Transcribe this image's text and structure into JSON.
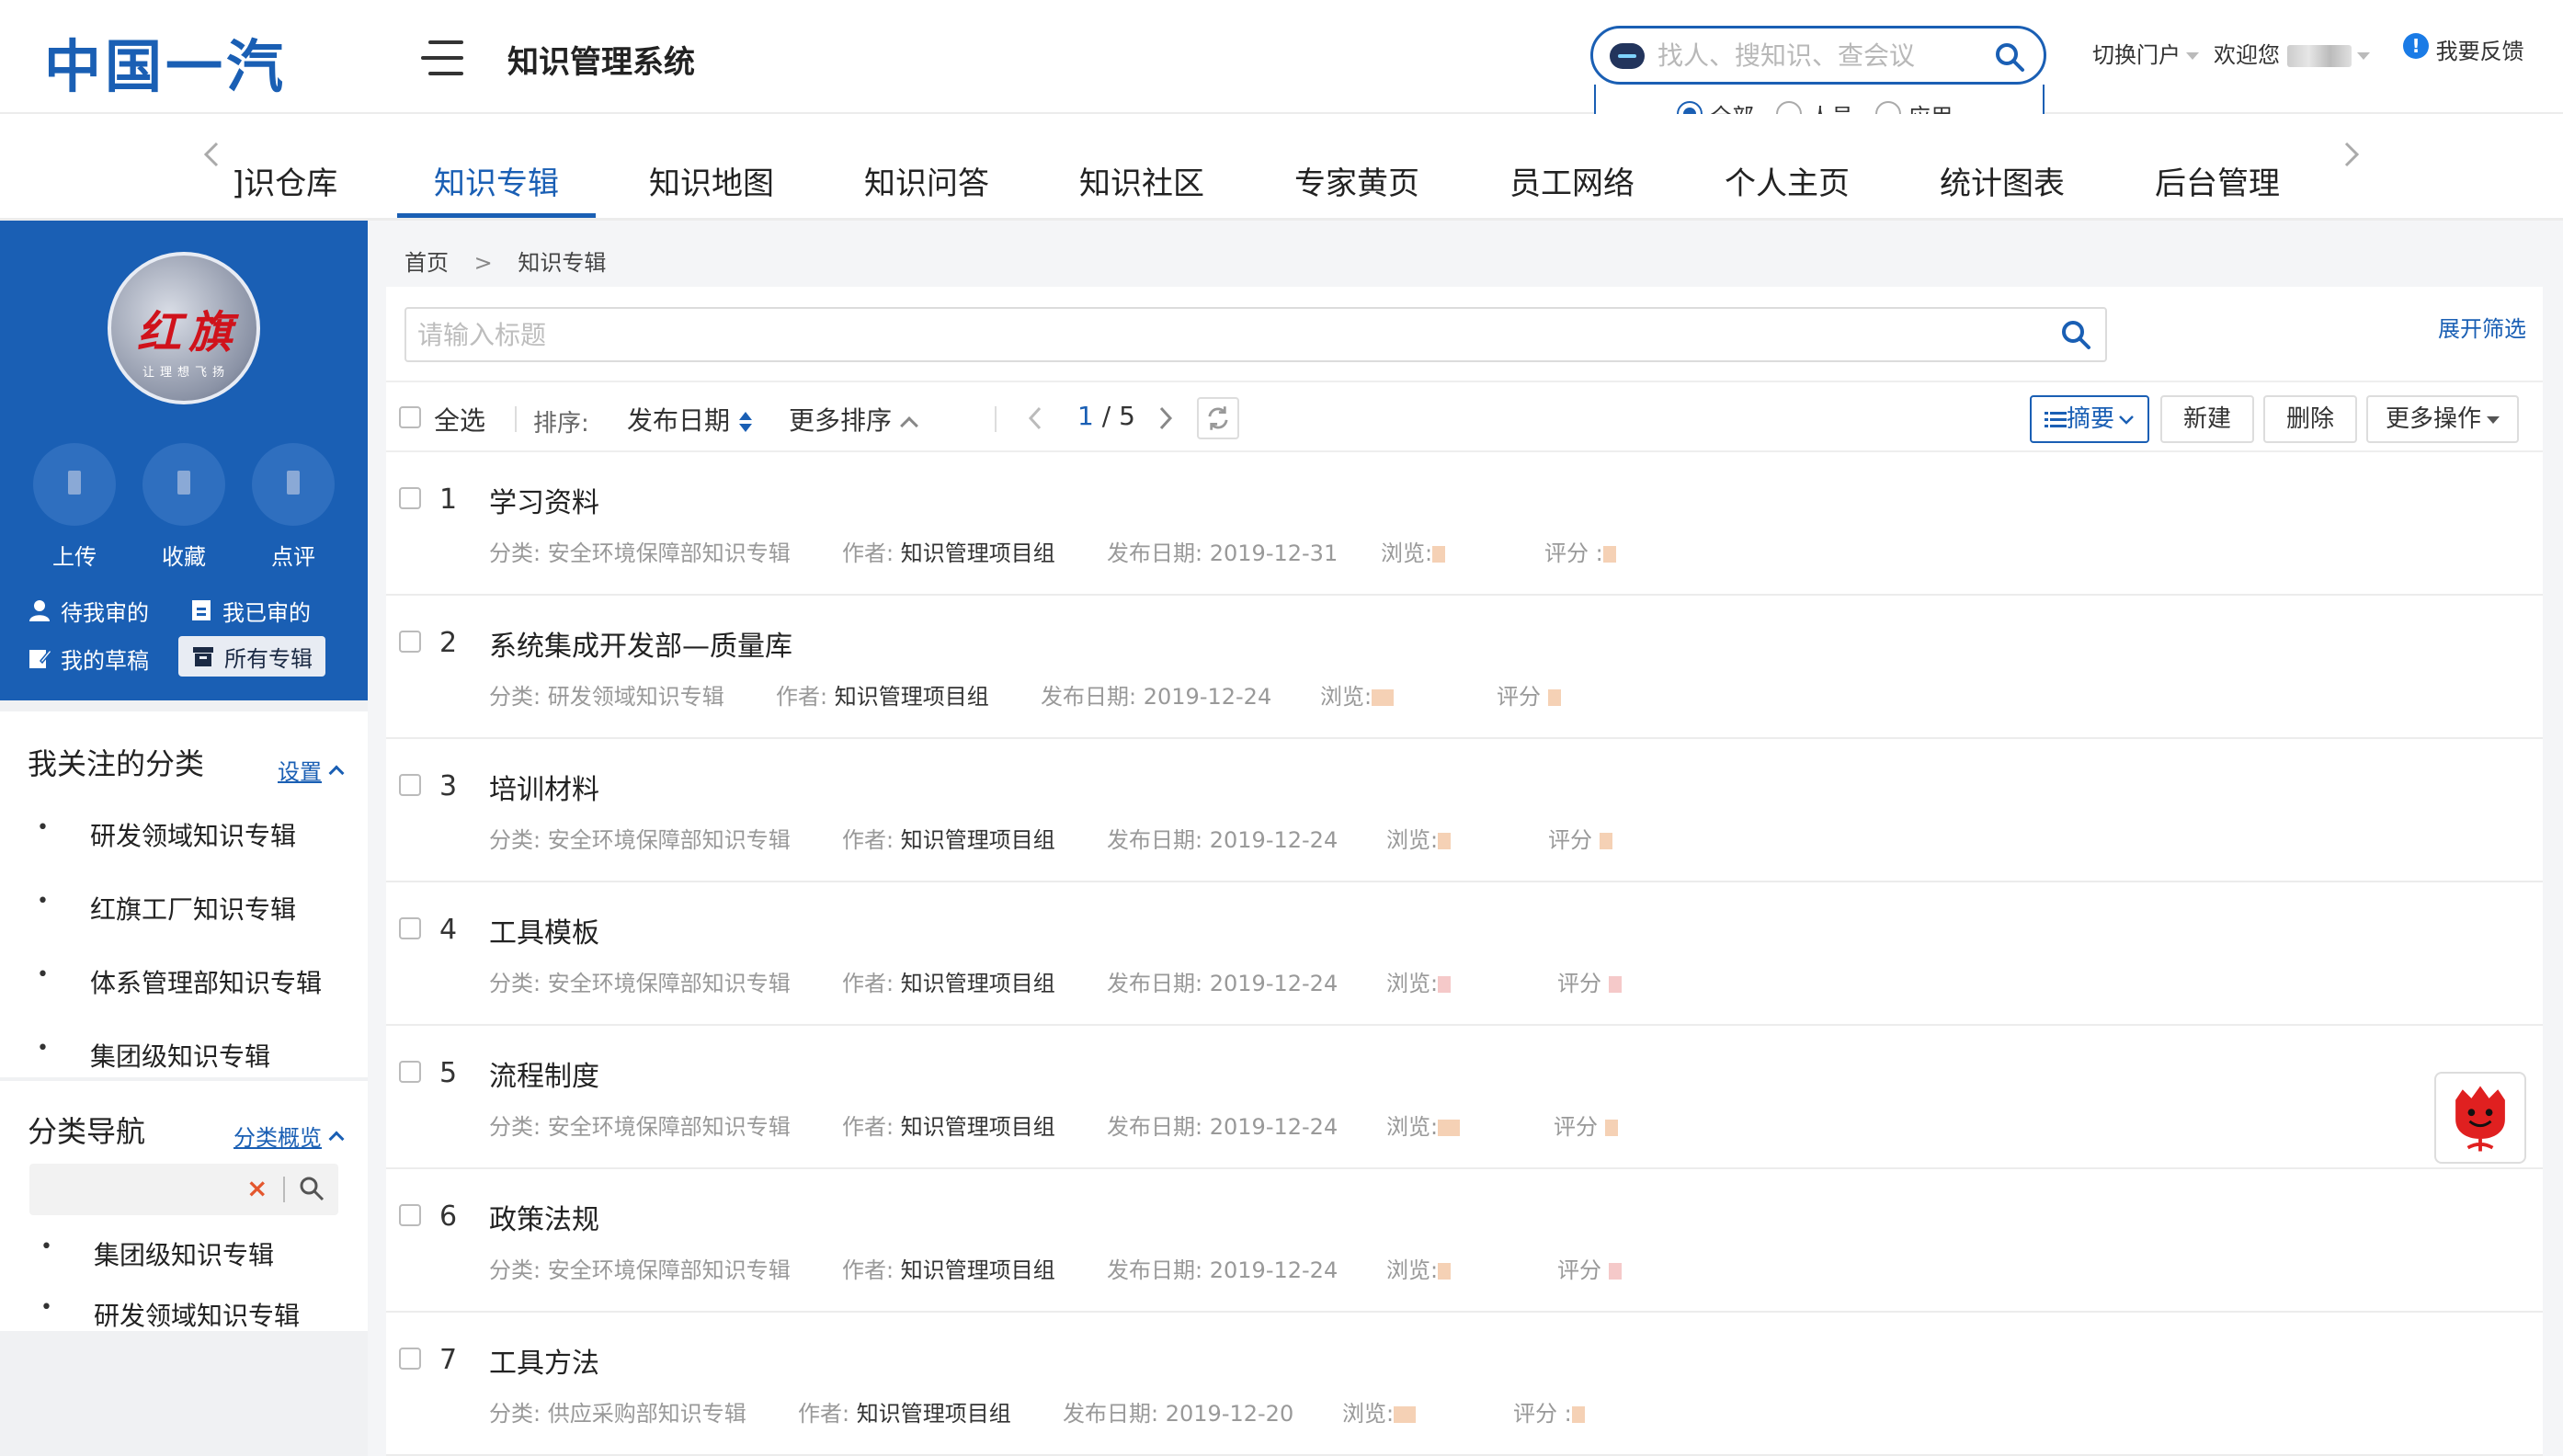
{
  "header": {
    "logo_text": "中国一汽",
    "system_title": "知识管理系统",
    "search_placeholder": "找人、搜知识、查会议",
    "scope_options": [
      {
        "label": "全部",
        "selected": true
      },
      {
        "label": "人员",
        "selected": false
      },
      {
        "label": "应用",
        "selected": false
      }
    ],
    "switch_portal": "切换门户",
    "welcome": "欢迎您",
    "feedback": "我要反馈",
    "feedback_badge": "!"
  },
  "nav": {
    "items": [
      "知识仓库",
      "知识专辑",
      "知识地图",
      "知识问答",
      "知识社区",
      "专家黄页",
      "员工网络",
      "个人主页",
      "统计图表",
      "后台管理"
    ],
    "first_item_visible": "]识仓库",
    "active": "知识专辑"
  },
  "sidebar": {
    "avatar_brand": "红旗",
    "avatar_slogan": "让理想飞扬",
    "actions": [
      "上传",
      "收藏",
      "点评"
    ],
    "links": [
      {
        "label": "待我审的",
        "icon": "user-icon"
      },
      {
        "label": "我已审的",
        "icon": "approved-icon"
      },
      {
        "label": "我的草稿",
        "icon": "draft-icon"
      },
      {
        "label": "所有专辑",
        "icon": "archive-icon",
        "selected": true
      }
    ],
    "followed": {
      "title": "我关注的分类",
      "settings_link": "设置",
      "items": [
        "研发领域知识专辑",
        "红旗工厂知识专辑",
        "体系管理部知识专辑",
        "集团级知识专辑"
      ]
    },
    "category_nav": {
      "title": "分类导航",
      "overview_link": "分类概览",
      "search_value": "",
      "clear_glyph": "×",
      "items": [
        "集团级知识专辑",
        "研发领域知识专辑"
      ]
    }
  },
  "breadcrumb": {
    "home": "首页",
    "separator": ">",
    "current": "知识专辑"
  },
  "main": {
    "title_placeholder": "请输入标题",
    "expand_filter": "展开筛选",
    "toolbar": {
      "select_all": "全选",
      "sort_label": "排序:",
      "sort_field": "发布日期",
      "more_sort": "更多排序",
      "page_current": "1",
      "page_sep": "/",
      "page_total": "5",
      "view_summary": "摘要",
      "new": "新建",
      "delete": "删除",
      "more_ops": "更多操作"
    },
    "labels": {
      "category": "分类:",
      "author": "作者:",
      "date": "发布日期:",
      "views": "浏览:",
      "rating": "评分"
    },
    "rows": [
      {
        "num": "1",
        "title": "学习资料",
        "category": "安全环境保障部知识专辑",
        "author": "知识管理项目组",
        "date": "2019-12-31",
        "rating_label": "评分 :"
      },
      {
        "num": "2",
        "title": "系统集成开发部—质量库",
        "category": "研发领域知识专辑",
        "author": "知识管理项目组",
        "date": "2019-12-24",
        "rating_label": "评分"
      },
      {
        "num": "3",
        "title": "培训材料",
        "category": "安全环境保障部知识专辑",
        "author": "知识管理项目组",
        "date": "2019-12-24",
        "rating_label": "评分"
      },
      {
        "num": "4",
        "title": "工具模板",
        "category": "安全环境保障部知识专辑",
        "author": "知识管理项目组",
        "date": "2019-12-24",
        "rating_label": "评分"
      },
      {
        "num": "5",
        "title": "流程制度",
        "category": "安全环境保障部知识专辑",
        "author": "知识管理项目组",
        "date": "2019-12-24",
        "rating_label": "评分"
      },
      {
        "num": "6",
        "title": "政策法规",
        "category": "安全环境保障部知识专辑",
        "author": "知识管理项目组",
        "date": "2019-12-24",
        "rating_label": "评分"
      },
      {
        "num": "7",
        "title": "工具方法",
        "category": "供应采购部知识专辑",
        "author": "知识管理项目组",
        "date": "2019-12-20",
        "rating_label": "评分 :"
      }
    ]
  },
  "colors": {
    "brand_blue": "#1a5fb4",
    "sidebar_blue": "#1a5fb4",
    "helper_red": "#e02020"
  }
}
